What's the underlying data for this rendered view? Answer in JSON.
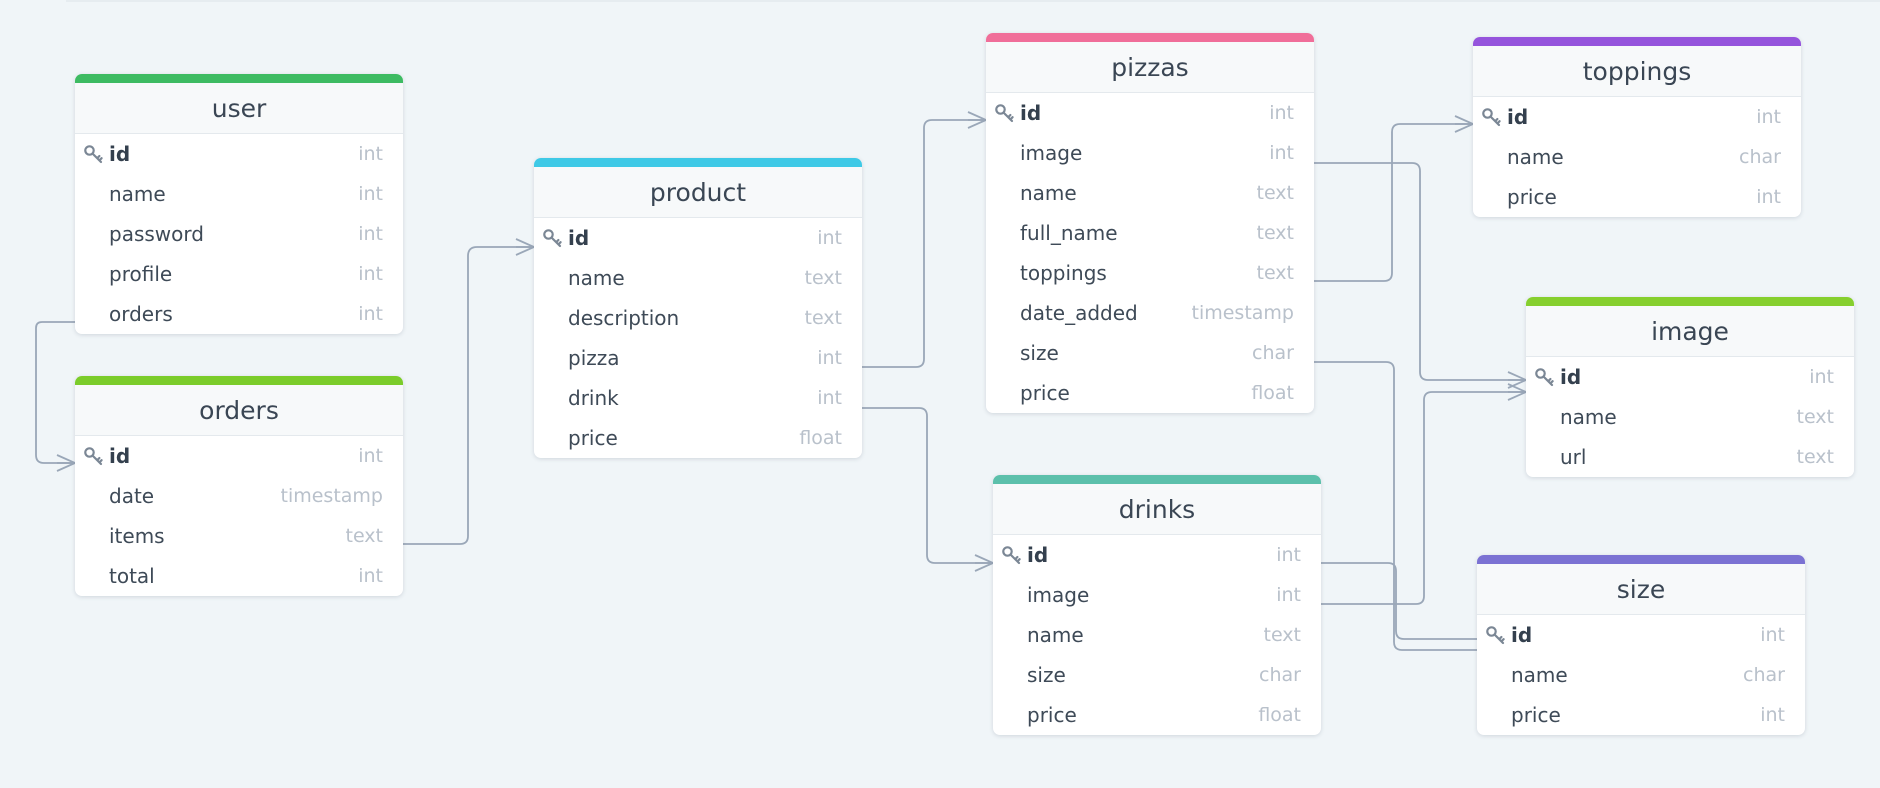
{
  "tables": {
    "user": {
      "name": "user",
      "color": "#3dbb62",
      "columns": [
        {
          "name": "id",
          "type": "int",
          "pk": true
        },
        {
          "name": "name",
          "type": "int"
        },
        {
          "name": "password",
          "type": "int"
        },
        {
          "name": "profile",
          "type": "int"
        },
        {
          "name": "orders",
          "type": "int"
        }
      ]
    },
    "orders": {
      "name": "orders",
      "color": "#7bcc2a",
      "columns": [
        {
          "name": "id",
          "type": "int",
          "pk": true
        },
        {
          "name": "date",
          "type": "timestamp"
        },
        {
          "name": "items",
          "type": "text"
        },
        {
          "name": "total",
          "type": "int"
        }
      ]
    },
    "product": {
      "name": "product",
      "color": "#3ec9e6",
      "columns": [
        {
          "name": "id",
          "type": "int",
          "pk": true
        },
        {
          "name": "name",
          "type": "text"
        },
        {
          "name": "description",
          "type": "text"
        },
        {
          "name": "pizza",
          "type": "int"
        },
        {
          "name": "drink",
          "type": "int"
        },
        {
          "name": "price",
          "type": "float"
        }
      ]
    },
    "pizzas": {
      "name": "pizzas",
      "color": "#f06e99",
      "columns": [
        {
          "name": "id",
          "type": "int",
          "pk": true
        },
        {
          "name": "image",
          "type": "int"
        },
        {
          "name": "name",
          "type": "text"
        },
        {
          "name": "full_name",
          "type": "text"
        },
        {
          "name": "toppings",
          "type": "text"
        },
        {
          "name": "date_added",
          "type": "timestamp"
        },
        {
          "name": "size",
          "type": "char"
        },
        {
          "name": "price",
          "type": "float"
        }
      ]
    },
    "drinks": {
      "name": "drinks",
      "color": "#5cc0ab",
      "columns": [
        {
          "name": "id",
          "type": "int",
          "pk": true
        },
        {
          "name": "image",
          "type": "int"
        },
        {
          "name": "name",
          "type": "text"
        },
        {
          "name": "size",
          "type": "char"
        },
        {
          "name": "price",
          "type": "float"
        }
      ]
    },
    "toppings": {
      "name": "toppings",
      "color": "#9554dc",
      "columns": [
        {
          "name": "id",
          "type": "int",
          "pk": true
        },
        {
          "name": "name",
          "type": "char"
        },
        {
          "name": "price",
          "type": "int"
        }
      ]
    },
    "image": {
      "name": "image",
      "color": "#86cf2e",
      "columns": [
        {
          "name": "id",
          "type": "int",
          "pk": true
        },
        {
          "name": "name",
          "type": "text"
        },
        {
          "name": "url",
          "type": "text"
        }
      ]
    },
    "size": {
      "name": "size",
      "color": "#7b72d3",
      "columns": [
        {
          "name": "id",
          "type": "int",
          "pk": true
        },
        {
          "name": "name",
          "type": "char"
        },
        {
          "name": "price",
          "type": "int"
        }
      ]
    }
  },
  "relationships": [
    {
      "from_table": "user",
      "from_column": "orders",
      "to_table": "orders",
      "to_column": "id"
    },
    {
      "from_table": "orders",
      "from_column": "items",
      "to_table": "product",
      "to_column": "id"
    },
    {
      "from_table": "product",
      "from_column": "pizza",
      "to_table": "pizzas",
      "to_column": "id"
    },
    {
      "from_table": "product",
      "from_column": "drink",
      "to_table": "drinks",
      "to_column": "id"
    },
    {
      "from_table": "pizzas",
      "from_column": "toppings",
      "to_table": "toppings",
      "to_column": "id"
    },
    {
      "from_table": "pizzas",
      "from_column": "image",
      "to_table": "image",
      "to_column": "id"
    },
    {
      "from_table": "drinks",
      "from_column": "image",
      "to_table": "image",
      "to_column": "id"
    },
    {
      "from_table": "pizzas",
      "from_column": "size",
      "to_table": "size",
      "to_column": "id"
    },
    {
      "from_table": "drinks",
      "from_column": "id",
      "to_table": "size",
      "to_column": "id"
    }
  ],
  "icons": {
    "primary_key": "key-icon"
  }
}
